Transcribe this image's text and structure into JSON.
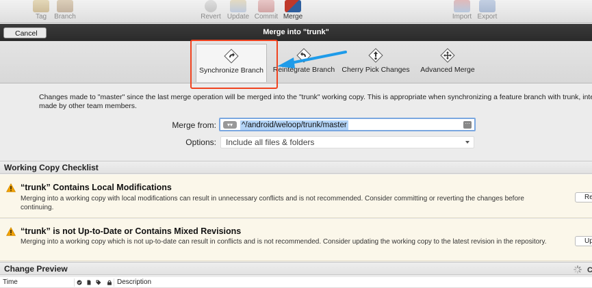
{
  "toolbar": {
    "items": [
      {
        "label": "Tag",
        "icon": "tag-icon"
      },
      {
        "label": "Branch",
        "icon": "branch-icon"
      },
      {
        "label": "Revert",
        "icon": "revert-icon"
      },
      {
        "label": "Update",
        "icon": "update-icon"
      },
      {
        "label": "Commit",
        "icon": "commit-icon"
      },
      {
        "label": "Merge",
        "icon": "merge-icon"
      },
      {
        "label": "Import",
        "icon": "import-icon"
      },
      {
        "label": "Export",
        "icon": "export-icon"
      }
    ]
  },
  "sheet": {
    "cancel_label": "Cancel",
    "title": "Merge into \"trunk\""
  },
  "modes": [
    {
      "label": "Synchronize Branch",
      "selected": true,
      "icon": "synchronize-icon"
    },
    {
      "label": "Reintegrate Branch",
      "selected": false,
      "icon": "reintegrate-icon"
    },
    {
      "label": "Cherry Pick Changes",
      "selected": false,
      "icon": "cherry-pick-icon"
    },
    {
      "label": "Advanced Merge",
      "selected": false,
      "icon": "advanced-merge-icon"
    }
  ],
  "description": {
    "line1": "Changes made to \"master\" since the last merge operation will be merged into the \"trunk\" working copy. This is appropriate when synchronizing a feature branch with trunk, integr",
    "line2": "made by other team members."
  },
  "form": {
    "merge_from_label": "Merge from:",
    "merge_from_value": "^/android/weloop/trunk/master",
    "options_label": "Options:",
    "options_value": "Include all files & folders"
  },
  "checklist": {
    "header": "Working Copy Checklist",
    "items": [
      {
        "title": "“trunk” Contains Local Modifications",
        "body_line1": "Merging into a working copy with local modifications can result in unnecessary conflicts and is not recommended. Consider committing or reverting the changes before",
        "body_line2": "continuing.",
        "button": "Re"
      },
      {
        "title": "“trunk” is not Up-to-Date or Contains Mixed Revisions",
        "body_line1": "Merging into a working copy which is not up-to-date can result in conflicts and is not recommended. Consider updating the working copy to the latest revision in the repository.",
        "body_line2": "",
        "button": "Up"
      }
    ]
  },
  "preview": {
    "header": "Change Preview",
    "right_label": "C",
    "columns": {
      "time": "Time",
      "description": "Description"
    }
  },
  "colors": {
    "highlight": "#f0431f",
    "arrow": "#1e9be9",
    "warning": "#f0a000"
  }
}
